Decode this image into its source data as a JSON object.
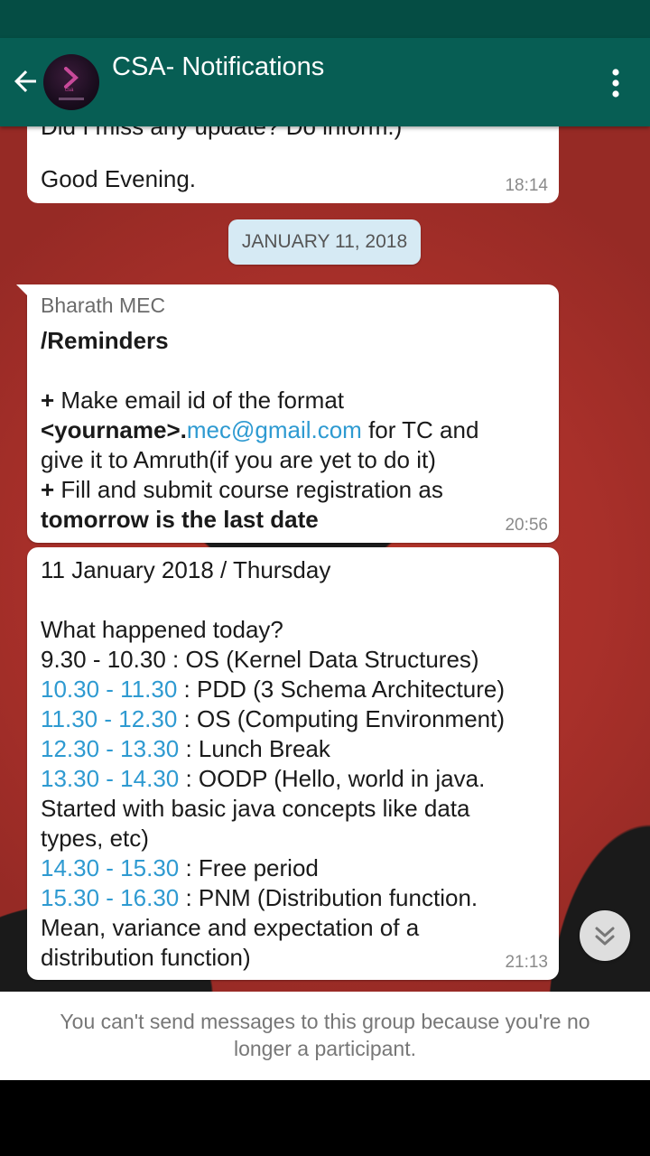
{
  "header": {
    "title": "CSA- Notifications",
    "back_icon": "arrow-left-icon",
    "menu_icon": "more-vert-icon",
    "color": "#075e54",
    "status_bar_color": "#054d44"
  },
  "messages": [
    {
      "partial_line": "Did I miss any update? Do inform.)",
      "text": "Good Evening.",
      "time": "18:14"
    },
    {
      "date": "JANUARY 11, 2018"
    },
    {
      "sender": "Bharath MEC",
      "heading": "/Reminders",
      "bullet1_prefix": "+",
      "bullet1_text": "Make email id of the format",
      "email_name": "<yourname>.",
      "email_link": "mec@gmail.com",
      "bullet1_suffix": " for TC and",
      "bullet1_line3": "give it to Amruth(if you are yet to do it)",
      "bullet2_prefix": "+",
      "bullet2_text": "Fill and submit course registration as",
      "bullet2_bold": "tomorrow is the last date",
      "time": "20:56"
    },
    {
      "line1": "11 January 2018 / Thursday",
      "question": "What happened today?",
      "schedule": [
        {
          "time": "9.30 - 10.30",
          "desc": " : OS (Kernel Data Structures)",
          "linked": false
        },
        {
          "time": "10.30 - 11.30",
          "desc": " : PDD (3 Schema Architecture)",
          "linked": true
        },
        {
          "time": "11.30 - 12.30",
          "desc": " : OS (Computing Environment)",
          "linked": true
        },
        {
          "time": "12.30 - 13.30",
          "desc": " : Lunch Break",
          "linked": true
        },
        {
          "time": "13.30 - 14.30",
          "desc": " : OODP (Hello, world in java.",
          "linked": true,
          "cont": [
            "Started with basic java concepts like data",
            "types, etc)"
          ]
        },
        {
          "time": "14.30 - 15.30",
          "desc": " : Free period",
          "linked": true
        },
        {
          "time": "15.30 - 16.30",
          "desc": " : PNM (Distribution function.",
          "linked": true,
          "cont": [
            "Mean, variance and expectation of a",
            "distribution function)"
          ]
        }
      ],
      "time": "21:13"
    }
  ],
  "scroll_button": {
    "icon": "double-chevron-down-icon"
  },
  "footer": {
    "text": "You can't send messages to this group because you're no longer a participant."
  },
  "colors": {
    "link": "#2e9ad1",
    "date_chip": "#d6eaf4"
  }
}
